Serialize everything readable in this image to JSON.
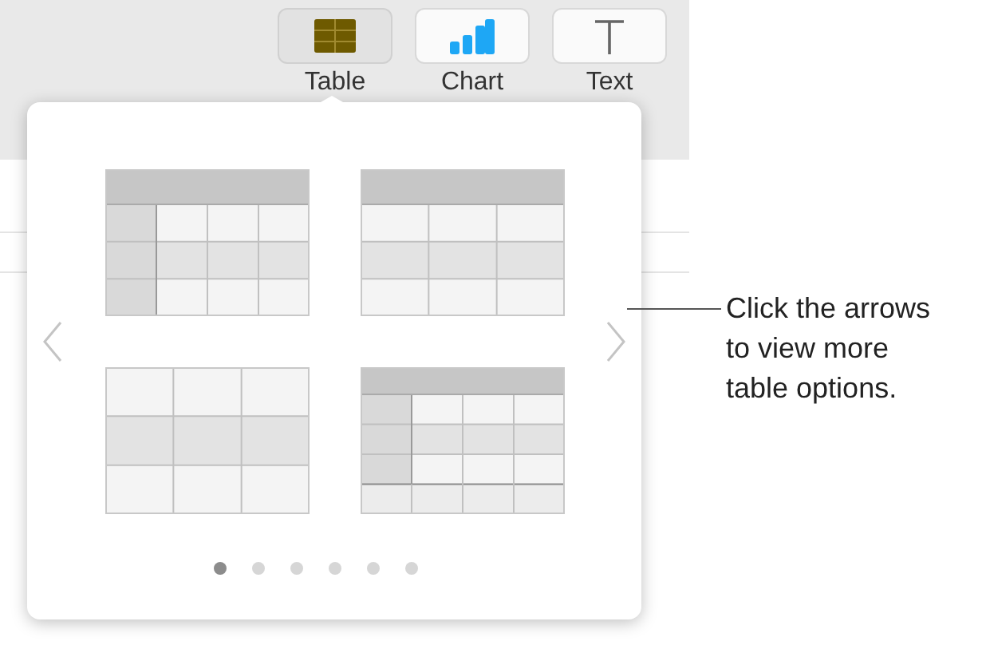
{
  "toolbar": {
    "buttons": [
      {
        "label": "Table",
        "kind": "table",
        "selected": true
      },
      {
        "label": "Chart",
        "kind": "chart",
        "selected": false
      },
      {
        "label": "Text",
        "kind": "text",
        "selected": false
      }
    ]
  },
  "popover": {
    "thumbnails": [
      {
        "kind": "header_column"
      },
      {
        "kind": "header"
      },
      {
        "kind": "plain"
      },
      {
        "kind": "header_column_footer"
      }
    ],
    "pages": [
      {
        "selected": true
      },
      {
        "selected": false
      },
      {
        "selected": false
      },
      {
        "selected": false
      },
      {
        "selected": false
      },
      {
        "selected": false
      }
    ]
  },
  "callout": {
    "text": "Click the arrows to view more table options."
  }
}
